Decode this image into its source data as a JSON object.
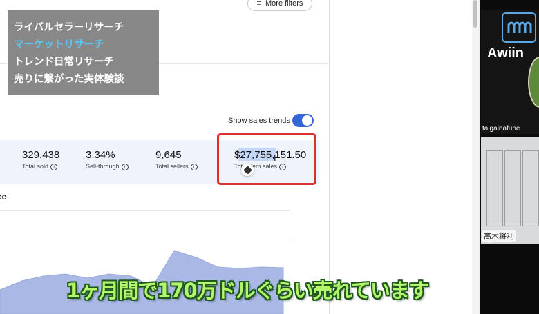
{
  "filters": {
    "more_filters_label": "More filters"
  },
  "overlay_menu": {
    "items": [
      {
        "label": "ライバルセラーリサーチ",
        "color": "#ffffff"
      },
      {
        "label": "マーケットリサーチ",
        "color": "#5cc6f2"
      },
      {
        "label": "トレンド日常リサーチ",
        "color": "#ffffff"
      },
      {
        "label": "売りに繋がった実体験談",
        "color": "#ffffff"
      }
    ]
  },
  "trends_toggle": {
    "label": "Show sales trends",
    "on": true,
    "accent": "#3367d6"
  },
  "stats": [
    {
      "value": "329,438",
      "label": "Total sold"
    },
    {
      "value": "3.34%",
      "label": "Sell-through"
    },
    {
      "value": "9,645",
      "label": "Total sellers"
    },
    {
      "value": "$27,755,151.50",
      "label": "Total item sales"
    }
  ],
  "section": {
    "title_fragment": "ce"
  },
  "chart_data": {
    "type": "area",
    "values": [
      0.35,
      0.48,
      0.55,
      0.58,
      0.52,
      0.58,
      0.55,
      0.4,
      0.92,
      0.82,
      0.68,
      0.66,
      0.68,
      0.67
    ],
    "color": "#aab8e6",
    "grid": true
  },
  "video": {
    "participants": [
      {
        "name": "taigainafune",
        "logo_text": "Awiin"
      },
      {
        "name": "高木将利"
      }
    ]
  },
  "subtitle": {
    "text": "1ヶ月間で170万ドルぐらい売れています",
    "color": "#b5f56a"
  }
}
